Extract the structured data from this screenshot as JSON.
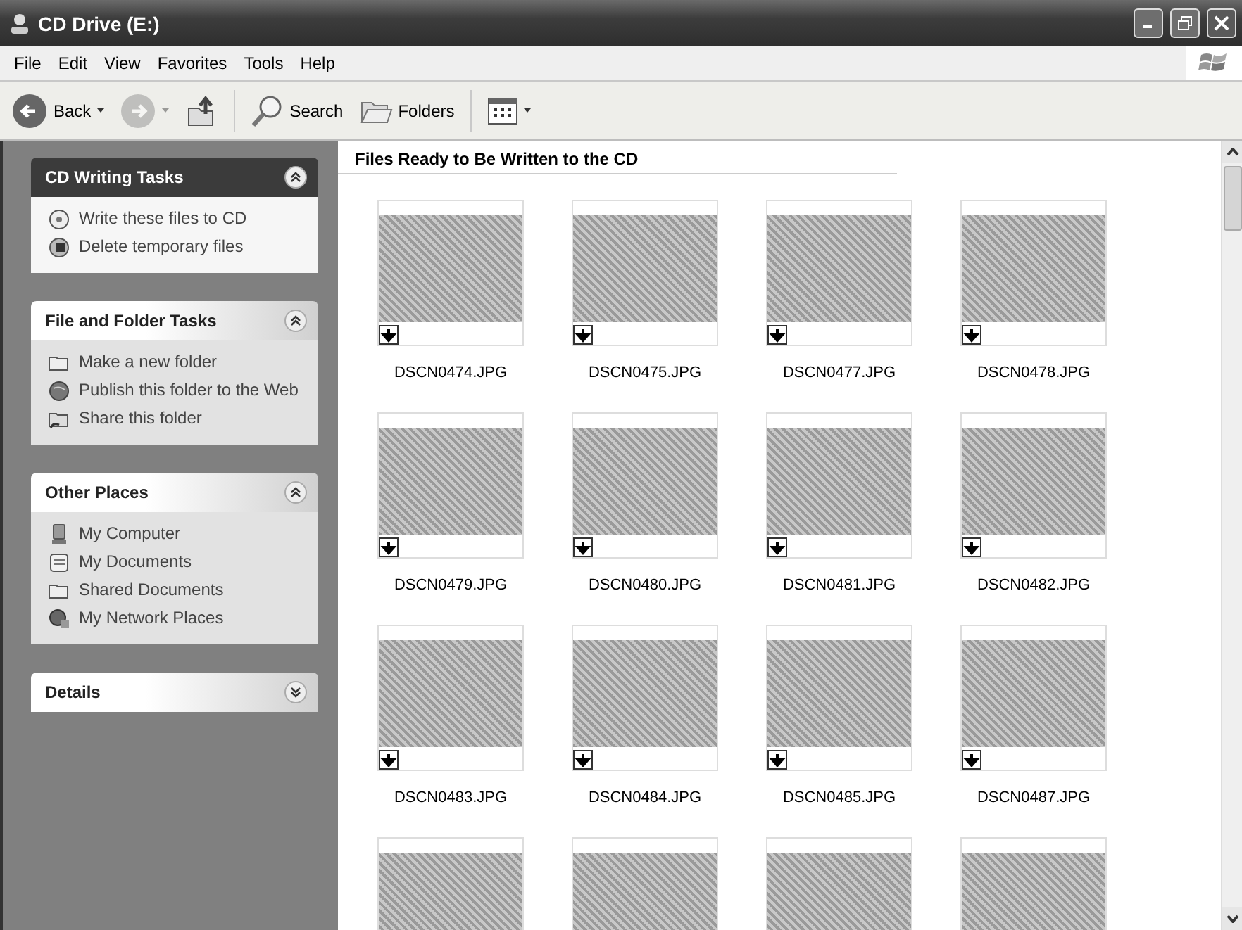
{
  "window": {
    "title": "CD Drive (E:)"
  },
  "menu": [
    "File",
    "Edit",
    "View",
    "Favorites",
    "Tools",
    "Help"
  ],
  "toolbar": [
    {
      "kind": "back",
      "label": "Back",
      "disabled": false
    },
    {
      "kind": "forward",
      "disabled": true
    },
    {
      "kind": "up",
      "disabled": false
    },
    {
      "kind": "separator"
    },
    {
      "kind": "search",
      "label": "Search",
      "disabled": false
    },
    {
      "kind": "folders",
      "label": "Folders",
      "disabled": false
    },
    {
      "kind": "separator"
    },
    {
      "kind": "views",
      "disabled": false
    }
  ],
  "sidebar": {
    "panels": [
      {
        "title": "CD Writing Tasks",
        "kind": "special",
        "expanded": true,
        "items": [
          {
            "label": "Write these files to CD"
          },
          {
            "label": "Delete temporary files"
          }
        ]
      },
      {
        "title": "File and Folder Tasks",
        "kind": "normal",
        "expanded": true,
        "items": [
          {
            "label": "Make a new folder"
          },
          {
            "label": "Publish this folder to the Web"
          },
          {
            "label": "Share this folder"
          }
        ]
      },
      {
        "title": "Other Places",
        "kind": "normal",
        "expanded": true,
        "items": [
          {
            "label": "My Computer"
          },
          {
            "label": "My Documents"
          },
          {
            "label": "Shared Documents"
          },
          {
            "label": "My Network Places"
          }
        ]
      },
      {
        "title": "Details",
        "kind": "normal",
        "expanded": false
      }
    ]
  },
  "content": {
    "heading": "Files Ready to Be Written to the CD",
    "files": [
      {
        "kind": "full",
        "name": "DSCN0474.JPG"
      },
      {
        "kind": "full",
        "name": "DSCN0475.JPG"
      },
      {
        "kind": "full",
        "name": "DSCN0477.JPG"
      },
      {
        "kind": "full",
        "name": "DSCN0478.JPG"
      },
      {
        "kind": "full",
        "name": "DSCN0479.JPG"
      },
      {
        "kind": "full",
        "name": "DSCN0480.JPG"
      },
      {
        "kind": "full",
        "name": "DSCN0481.JPG"
      },
      {
        "kind": "full",
        "name": "DSCN0482.JPG"
      },
      {
        "kind": "full",
        "name": "DSCN0483.JPG"
      },
      {
        "kind": "full",
        "name": "DSCN0484.JPG"
      },
      {
        "kind": "full",
        "name": "DSCN0485.JPG"
      },
      {
        "kind": "full",
        "name": "DSCN0487.JPG"
      },
      {
        "kind": "cut"
      },
      {
        "kind": "cut"
      },
      {
        "kind": "cut"
      },
      {
        "kind": "cut"
      }
    ]
  }
}
